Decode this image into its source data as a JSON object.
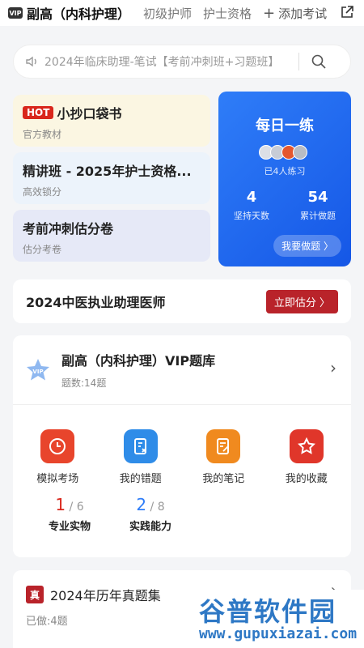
{
  "topbar": {
    "title": "副高（内科护理）",
    "tabs": [
      "初级护师",
      "护士资格"
    ],
    "add_exam": "添加考试"
  },
  "search": {
    "placeholder": "2024年临床助理-笔试【考前冲刺班+习题班】"
  },
  "cards": [
    {
      "badge": "HOT",
      "title": "小抄口袋书",
      "sub": "官方教材"
    },
    {
      "title": "精讲班 - 2025年护士资格...",
      "sub": "高效锁分"
    },
    {
      "title": "考前冲刺估分卷",
      "sub": "估分考卷"
    }
  ],
  "daily": {
    "title": "每日一练",
    "practiced": "已4人练习",
    "days_num": "4",
    "days_label": "坚持天数",
    "total_num": "54",
    "total_label": "累计做题",
    "button": "我要做题 〉"
  },
  "estimate": {
    "label": "2024中医执业助理医师",
    "button": "立即估分 〉"
  },
  "bank": {
    "name": "副高（内科护理）VIP题库",
    "count": "题数:14题",
    "icons": [
      {
        "label": "模拟考场",
        "icon": "clock-icon",
        "color": "#e8452c"
      },
      {
        "label": "我的错题",
        "icon": "wrong-book-icon",
        "color": "#2f8ce8"
      },
      {
        "label": "我的笔记",
        "icon": "note-icon",
        "color": "#f08a1f"
      },
      {
        "label": "我的收藏",
        "icon": "star-icon",
        "color": "#e0362a"
      }
    ],
    "progress": [
      {
        "done": "1",
        "total": "/ 6",
        "label": "专业实物",
        "color": "#d9271c"
      },
      {
        "done": "2",
        "total": "/ 8",
        "label": "实践能力",
        "color": "#2f7df8"
      }
    ]
  },
  "past": {
    "badge": "真",
    "title": "2024年历年真题集",
    "sub": "已做:4题"
  },
  "watermark": {
    "main": "谷普软件园",
    "url": "www.gupuxiazai.com"
  }
}
